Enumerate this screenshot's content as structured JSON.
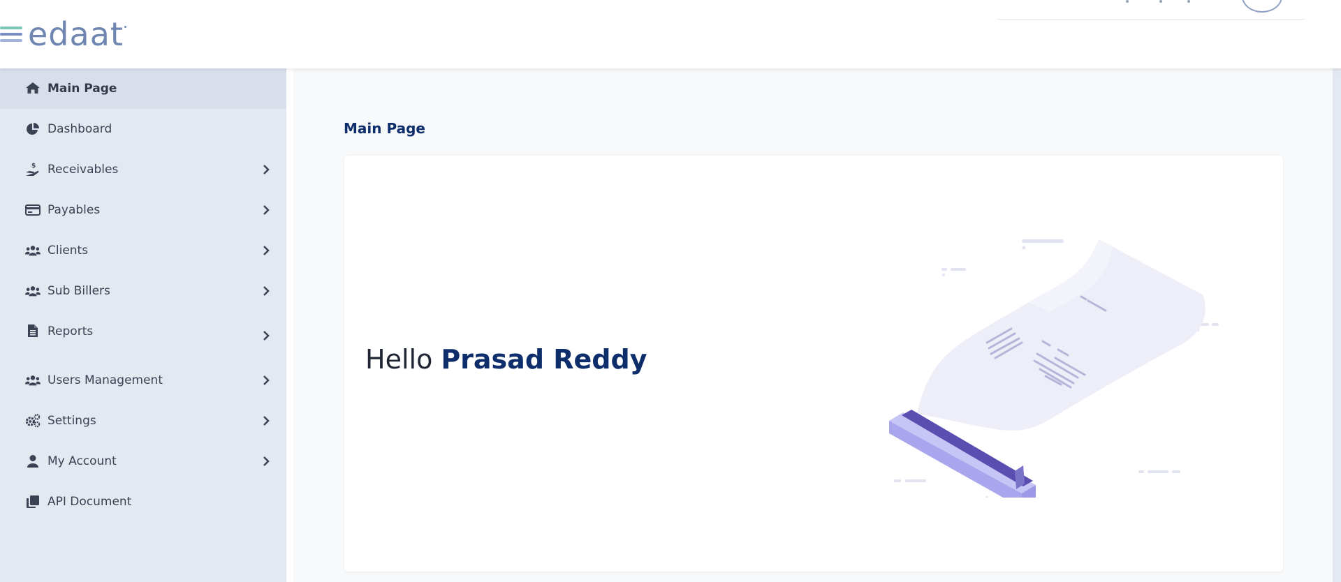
{
  "app": {
    "logo_text": "edaat",
    "logo_line_colors": [
      "#7cc6b8",
      "#7b8fc7",
      "#a2b4d9"
    ],
    "brand_color": "#0e2d6b"
  },
  "sidebar": {
    "items": [
      {
        "label": "Main Page",
        "icon": "home-icon",
        "active": true,
        "has_submenu": false
      },
      {
        "label": "Dashboard",
        "icon": "pie-chart-icon",
        "active": false,
        "has_submenu": false
      },
      {
        "label": "Receivables",
        "icon": "hand-dollar-icon",
        "active": false,
        "has_submenu": true
      },
      {
        "label": "Payables",
        "icon": "credit-card-icon",
        "active": false,
        "has_submenu": true
      },
      {
        "label": "Clients",
        "icon": "users-icon",
        "active": false,
        "has_submenu": true
      },
      {
        "label": "Sub Billers",
        "icon": "users-icon",
        "active": false,
        "has_submenu": true
      },
      {
        "label": "Reports",
        "icon": "file-icon",
        "active": false,
        "has_submenu": true
      },
      {
        "label": "Users Management",
        "icon": "users-icon",
        "active": false,
        "has_submenu": true
      },
      {
        "label": "Settings",
        "icon": "gears-icon",
        "active": false,
        "has_submenu": true
      },
      {
        "label": "My Account",
        "icon": "user-icon",
        "active": false,
        "has_submenu": true
      },
      {
        "label": "API Document",
        "icon": "copy-icon",
        "active": false,
        "has_submenu": false
      }
    ]
  },
  "main": {
    "page_title": "Main Page",
    "greeting_prefix": "Hello",
    "user_name": "Prasad Reddy"
  }
}
